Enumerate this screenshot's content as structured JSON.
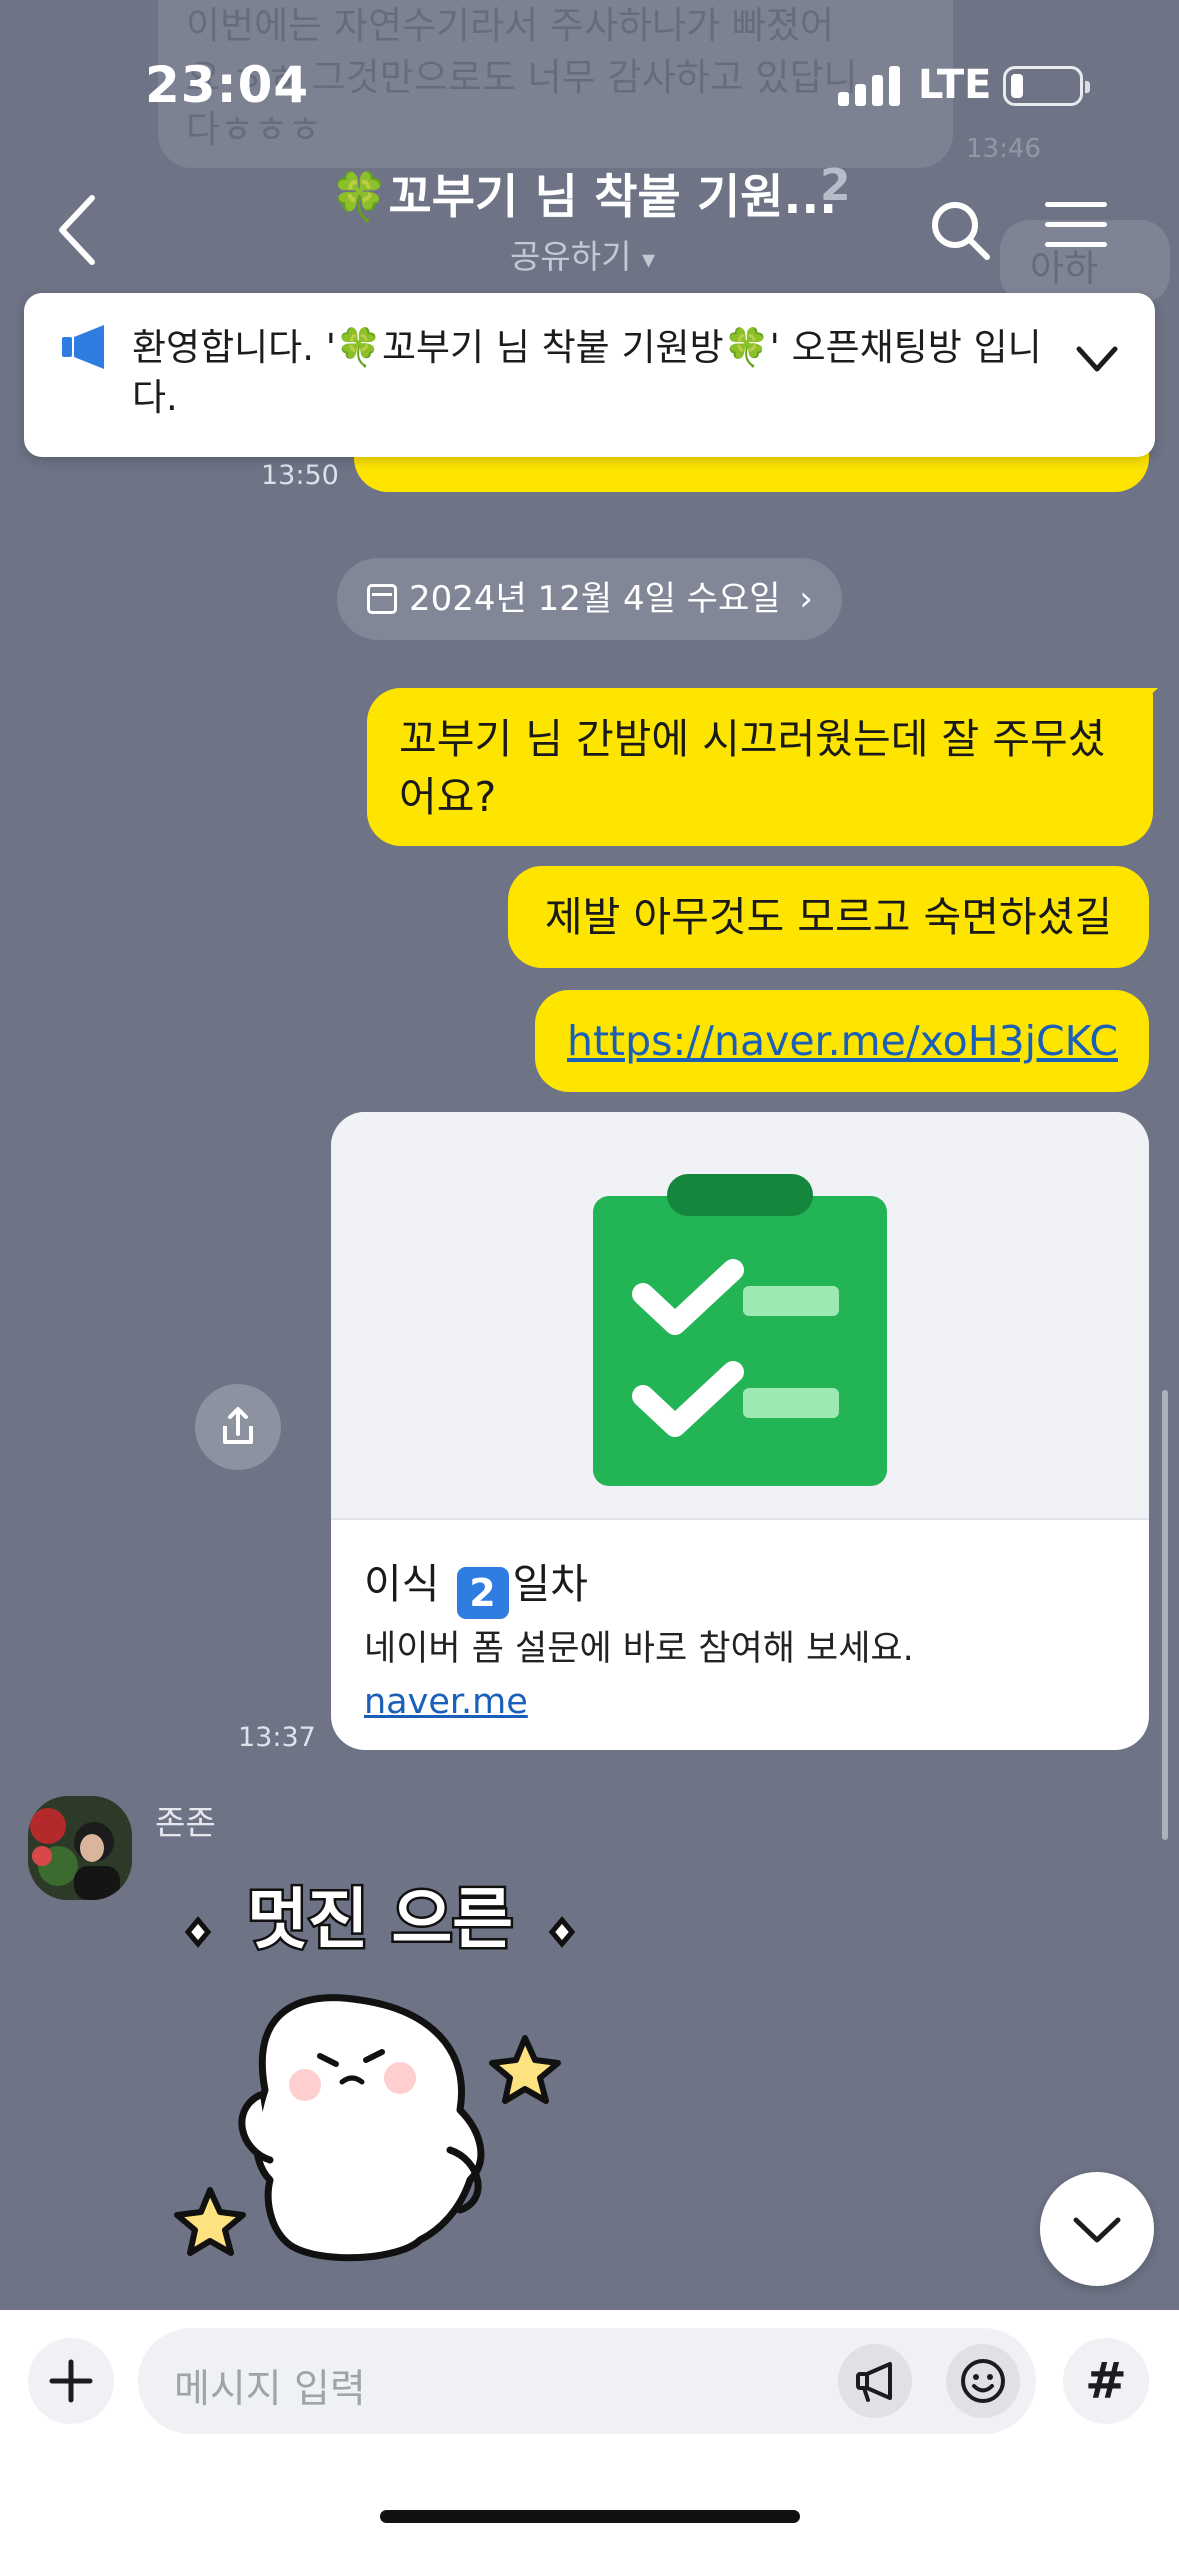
{
  "background_message": {
    "text_line1": "이번에는 자연수기라서 주사하나가 빠졌어",
    "text_line2": "요 ㅎㅎ 그것만으로도 너무 감사하고 있답니",
    "text_line3": "다ㅎㅎㅎ",
    "time": "13:46",
    "yellow_text": "아하"
  },
  "status_bar": {
    "time": "23:04",
    "network": "LTE"
  },
  "header": {
    "title": "꼬부기 님 착붙 기원...",
    "title_prefix_emoji": "🍀",
    "member_count": "2",
    "share_label": "공유하기",
    "share_caret": "▾"
  },
  "notice": {
    "text": "환영합니다. '🍀꼬부기 님 착붙 기원방🍀' 오픈채팅방 입니다."
  },
  "peek": {
    "time": "13:50"
  },
  "date_divider": {
    "label": "2024년 12월 4일 수요일",
    "chevron": "›"
  },
  "messages": [
    {
      "text": "꼬부기 님 간밤에 시끄러웠는데 잘 주무셨어요?"
    },
    {
      "text": "제발 아무것도 모르고 숙면하셨길"
    },
    {
      "text": "https://naver.me/xoH3jCKC"
    }
  ],
  "link_card": {
    "title_prefix": "이식",
    "title_keycap": "2",
    "title_suffix": "일차",
    "description": "네이버 폼 설문에 바로 참여해 보세요.",
    "domain": "naver.me",
    "time": "13:37"
  },
  "other_user": {
    "name": "존존",
    "sticker_text": "멋진 으른"
  },
  "composer": {
    "placeholder": "메시지 입력",
    "hash": "#"
  },
  "colors": {
    "chat_background": "#6e7486",
    "my_bubble": "#fee500",
    "link": "#1a5fb8",
    "notice_icon": "#2f7de1",
    "clipboard_green": "#22b455"
  }
}
